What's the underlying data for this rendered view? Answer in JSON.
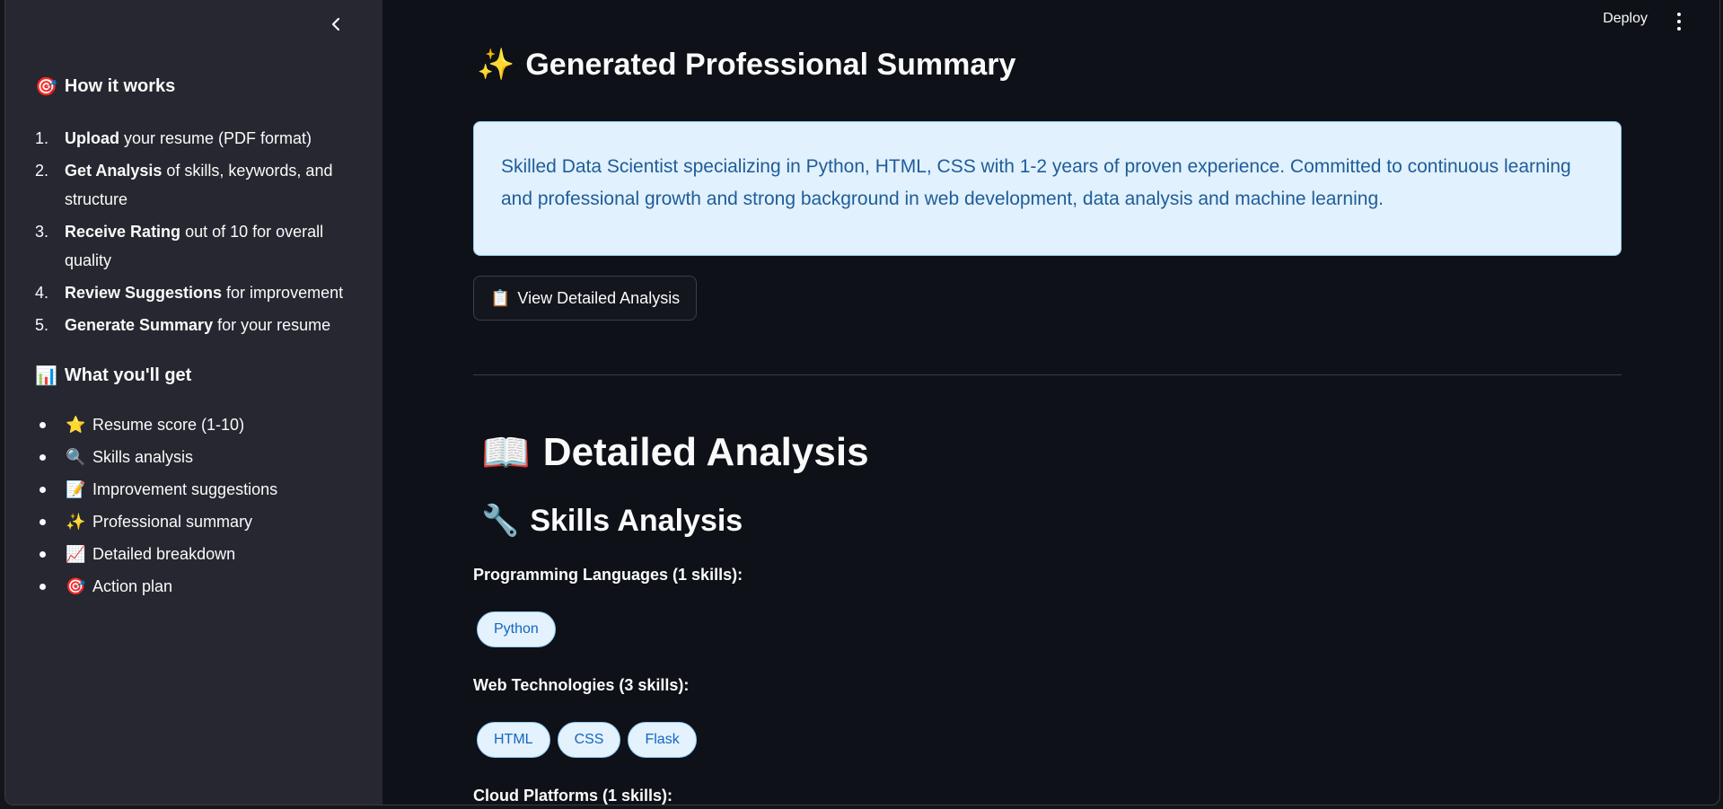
{
  "sidebar": {
    "how_heading": {
      "emoji": "🎯",
      "text": "How it works"
    },
    "steps": [
      {
        "num": "1.",
        "bold": "Upload",
        "rest": " your resume (PDF format)"
      },
      {
        "num": "2.",
        "bold": "Get Analysis",
        "rest": " of skills, keywords, and structure"
      },
      {
        "num": "3.",
        "bold": "Receive Rating",
        "rest": " out of 10 for overall quality"
      },
      {
        "num": "4.",
        "bold": "Review Suggestions",
        "rest": " for improvement"
      },
      {
        "num": "5.",
        "bold": "Generate Summary",
        "rest": " for your resume"
      }
    ],
    "get_heading": {
      "emoji": "📊",
      "text": "What you'll get"
    },
    "gets": [
      {
        "emoji": "⭐",
        "text": "Resume score (1-10)"
      },
      {
        "emoji": "🔍",
        "text": "Skills analysis"
      },
      {
        "emoji": "📝",
        "text": "Improvement suggestions"
      },
      {
        "emoji": "✨",
        "text": "Professional summary"
      },
      {
        "emoji": "📈",
        "text": "Detailed breakdown"
      },
      {
        "emoji": "🎯",
        "text": "Action plan"
      }
    ]
  },
  "header": {
    "deploy_label": "Deploy"
  },
  "main": {
    "generated_heading": {
      "emoji": "✨",
      "text": "Generated Professional Summary"
    },
    "summary_text": "Skilled Data Scientist specializing in Python, HTML, CSS with 1-2 years of proven experience. Committed to continuous learning and professional growth and strong background in web development, data analysis and machine learning.",
    "view_button": {
      "emoji": "📋",
      "label": "View Detailed Analysis"
    },
    "detail_heading": {
      "emoji": "📖",
      "text": "Detailed Analysis"
    },
    "skills_heading": {
      "emoji": "🔧",
      "text": "Skills Analysis"
    },
    "categories": [
      {
        "label": "Programming Languages (1 skills):",
        "skills": [
          "Python"
        ]
      },
      {
        "label": "Web Technologies (3 skills):",
        "skills": [
          "HTML",
          "CSS",
          "Flask"
        ]
      },
      {
        "label": "Cloud Platforms (1 skills):",
        "skills": []
      }
    ]
  },
  "colors": {
    "sidebar_bg": "#262730",
    "main_bg": "#0e1117",
    "info_bg": "#e1f1fd",
    "info_text": "#1f5d99",
    "pill_bg": "#e3f2fd",
    "pill_text": "#1565c0"
  }
}
